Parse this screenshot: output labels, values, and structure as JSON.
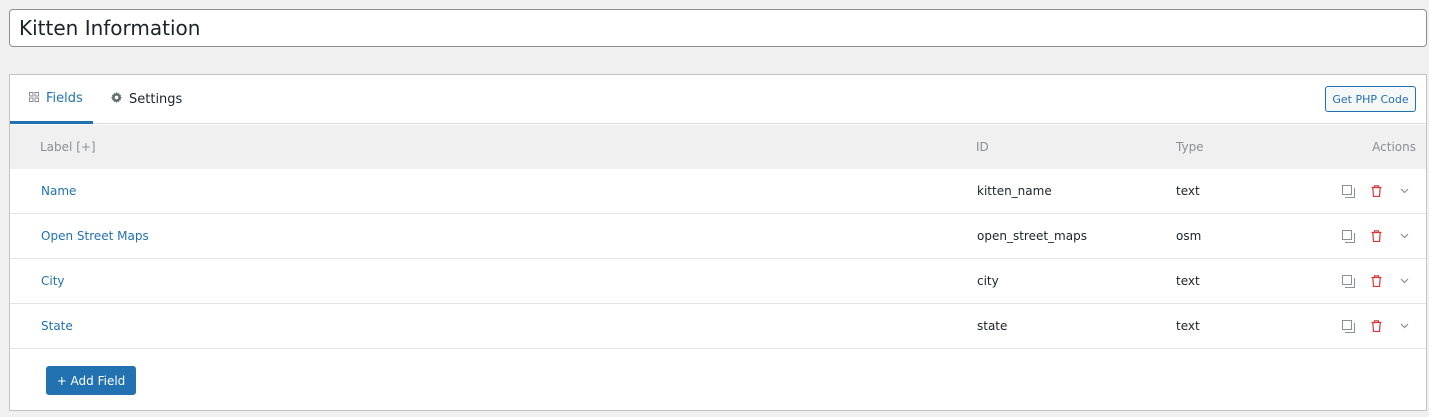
{
  "post": {
    "title": "Kitten Information"
  },
  "tabs": [
    {
      "label": "Fields",
      "icon": "grid-icon",
      "active": true
    },
    {
      "label": "Settings",
      "icon": "gear-icon",
      "active": false
    }
  ],
  "toolbar": {
    "php_label": "Get PHP Code"
  },
  "table": {
    "headers": {
      "label": "Label [+]",
      "id": "ID",
      "type": "Type",
      "actions": "Actions"
    },
    "rows": [
      {
        "label": "Name",
        "id": "kitten_name",
        "type": "text"
      },
      {
        "label": "Open Street Maps",
        "id": "open_street_maps",
        "type": "osm"
      },
      {
        "label": "City",
        "id": "city",
        "type": "text"
      },
      {
        "label": "State",
        "id": "state",
        "type": "text"
      }
    ],
    "row_actions": [
      "duplicate-icon",
      "trash-icon",
      "chevron-down-icon"
    ]
  },
  "add_field": {
    "label": "+ Add Field"
  },
  "colors": {
    "accent": "#2271b1",
    "danger": "#d63638",
    "background": "#f0f0f1"
  }
}
